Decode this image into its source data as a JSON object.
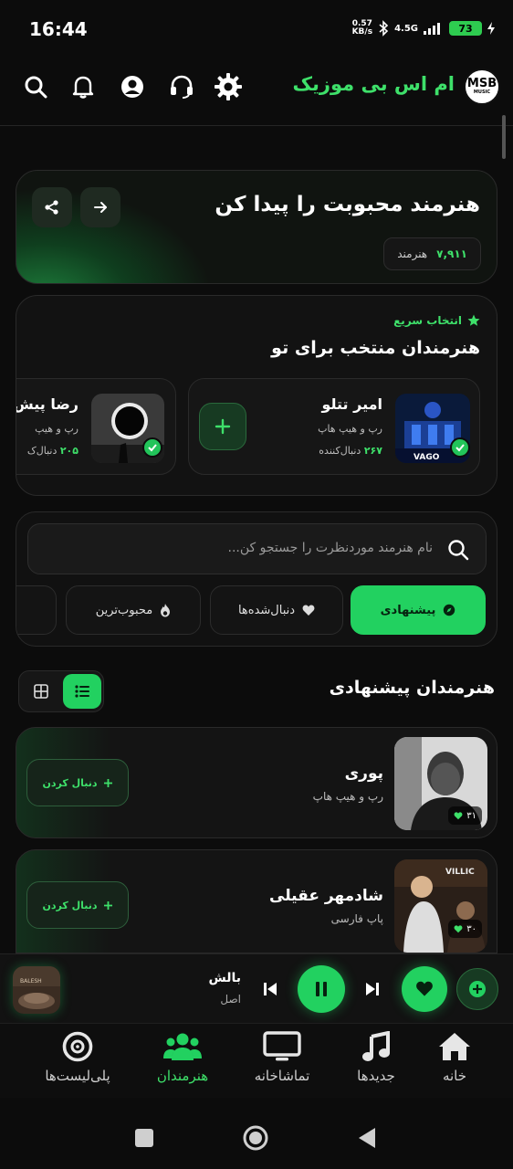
{
  "status_bar": {
    "time": "16:44",
    "speed_value": "0.57",
    "speed_unit": "KB/s",
    "network": "4.5G",
    "battery": "73"
  },
  "header": {
    "app_title": "ام اس بی موزیک",
    "logo_text": "MSB",
    "logo_sub": "MUSIC",
    "icons": [
      "search-icon",
      "bell-icon",
      "user-icon",
      "headset-icon",
      "gear-icon"
    ]
  },
  "hero": {
    "title": "هنرمند محبوبت را پیدا کن",
    "stat_value": "۷,۹۱۱",
    "stat_label": "هنرمند"
  },
  "quick_pick": {
    "badge": "انتخاب سریع",
    "title": "هنرمندان منتخب برای تو",
    "items": [
      {
        "name": "امیر تتلو",
        "genre": "رپ و هیپ هاپ",
        "followers": "۲۶۷",
        "followers_label": "دنبال‌کننده"
      },
      {
        "name": "رضا پیش",
        "genre": "رپ و هیپ",
        "followers": "۲۰۵",
        "followers_label": "دنبال‌ک"
      }
    ]
  },
  "search": {
    "placeholder": "نام هنرمند موردنظرت را جستجو کن...",
    "chips": [
      {
        "label": "پیشنهادی",
        "active": true
      },
      {
        "label": "دنبال‌شده‌ها",
        "active": false
      },
      {
        "label": "محبوب‌ترین",
        "active": false
      }
    ]
  },
  "suggested": {
    "title": "هنرمندان پیشنهادی",
    "follow_label": "دنبال کردن",
    "artists": [
      {
        "name": "پوری",
        "genre": "رپ و هیپ هاپ",
        "likes": "۳۱"
      },
      {
        "name": "شادمهر عقیلی",
        "genre": "پاپ فارسی",
        "likes": "۳۰"
      }
    ]
  },
  "player": {
    "title": "بالش",
    "subtitle": "اصل",
    "art_text": "BALESH"
  },
  "bottom_nav": [
    {
      "label": "خانه",
      "icon": "home-icon",
      "active": false
    },
    {
      "label": "جدیدها",
      "icon": "music-note-icon",
      "active": false
    },
    {
      "label": "تماشاخانه",
      "icon": "tv-icon",
      "active": false
    },
    {
      "label": "هنرمندان",
      "icon": "users-icon",
      "active": true
    },
    {
      "label": "پلی‌لیست‌ها",
      "icon": "disc-icon",
      "active": false
    }
  ],
  "colors": {
    "accent": "#22d160",
    "accent_text": "#3ee06a",
    "background": "#0c0c0c",
    "card": "#141414"
  }
}
